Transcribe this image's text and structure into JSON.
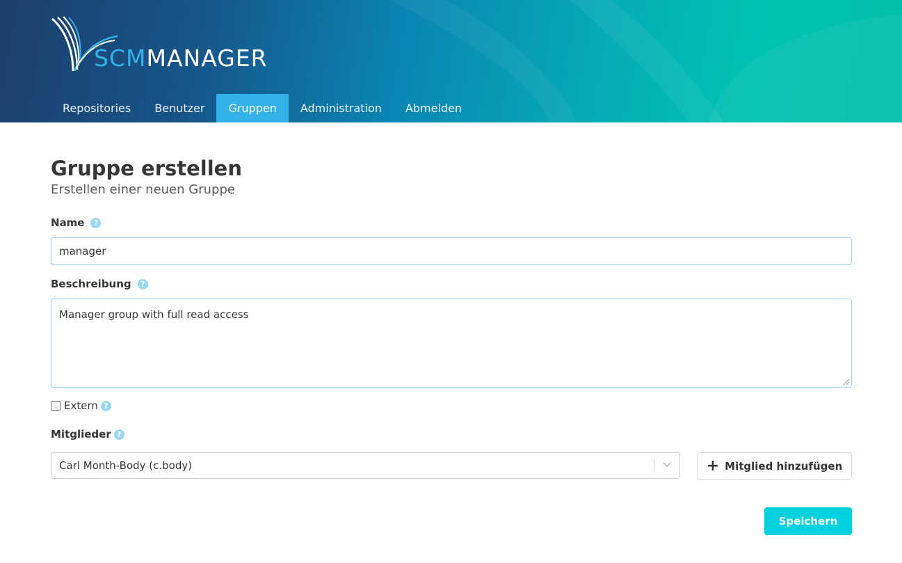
{
  "brand": {
    "part1": "SCM",
    "part2": "MANAGER"
  },
  "nav": {
    "items": [
      {
        "label": "Repositories"
      },
      {
        "label": "Benutzer"
      },
      {
        "label": "Gruppen"
      },
      {
        "label": "Administration"
      },
      {
        "label": "Abmelden"
      }
    ],
    "active": "Gruppen"
  },
  "page": {
    "title": "Gruppe erstellen",
    "subtitle": "Erstellen einer neuen Gruppe"
  },
  "form": {
    "name_label": "Name",
    "name_value": "manager",
    "description_label": "Beschreibung",
    "description_value": "Manager group with full read access",
    "extern_label": "Extern",
    "extern_checked": false,
    "members_label": "Mitglieder",
    "member_select_value": "Carl Month-Body (c.body)",
    "add_member_label": "Mitglied hinzufügen",
    "save_label": "Speichern",
    "help_glyph": "?"
  },
  "colors": {
    "accent": "#33b2e8",
    "primary_button": "#00d1df",
    "input_border": "#98d8f3"
  }
}
